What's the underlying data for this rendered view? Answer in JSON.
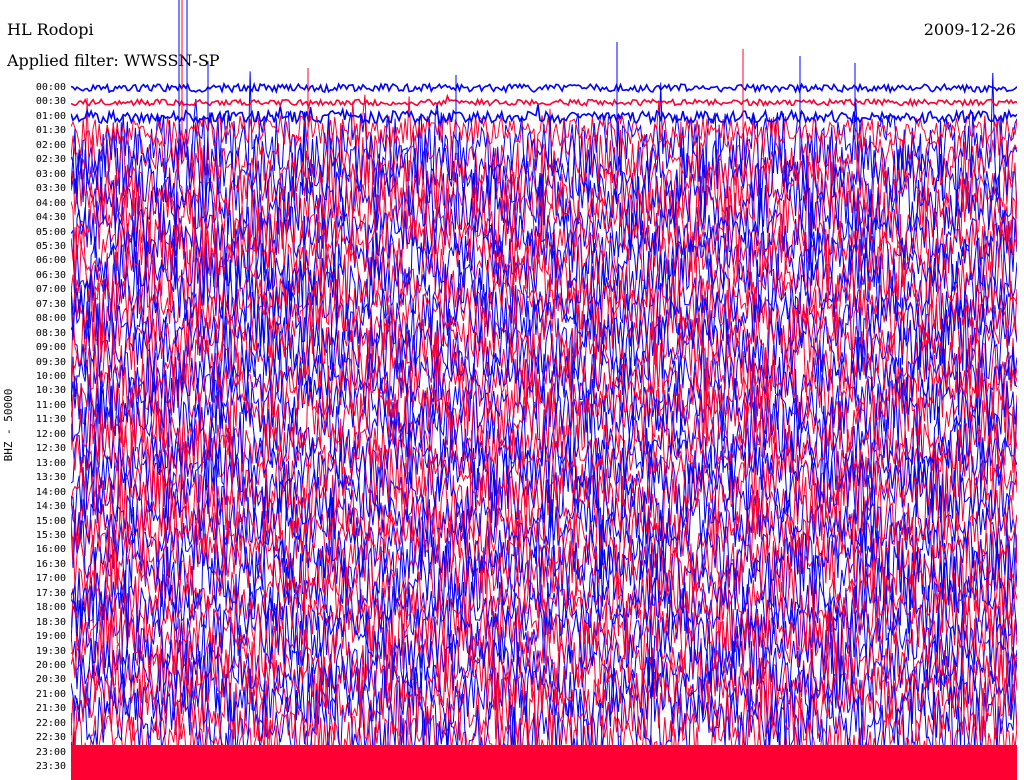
{
  "header": {
    "station": "HL Rodopi",
    "date": "2009-12-26",
    "filter": "Applied filter: WWSSN-SP",
    "channel": "BHZ - 50000"
  },
  "chart_data": {
    "type": "line",
    "title": "HL Rodopi",
    "ylabel": "BHZ - 50000",
    "y_tick_labels": [
      "00:00",
      "00:30",
      "01:00",
      "01:30",
      "02:00",
      "02:30",
      "03:00",
      "03:30",
      "04:00",
      "04:30",
      "05:00",
      "05:30",
      "06:00",
      "06:30",
      "07:00",
      "07:30",
      "08:00",
      "08:30",
      "09:00",
      "09:30",
      "10:00",
      "10:30",
      "11:00",
      "11:30",
      "12:00",
      "12:30",
      "13:00",
      "13:30",
      "14:00",
      "14:30",
      "15:00",
      "15:30",
      "16:00",
      "16:30",
      "17:00",
      "17:30",
      "18:00",
      "18:30",
      "19:00",
      "19:30",
      "20:00",
      "20:30",
      "21:00",
      "21:30",
      "22:00",
      "22:30",
      "23:00",
      "23:30"
    ],
    "trace_colors": [
      "#0000ff",
      "#ff0033"
    ],
    "trace_count": 48,
    "grid": false,
    "legend": "none"
  }
}
